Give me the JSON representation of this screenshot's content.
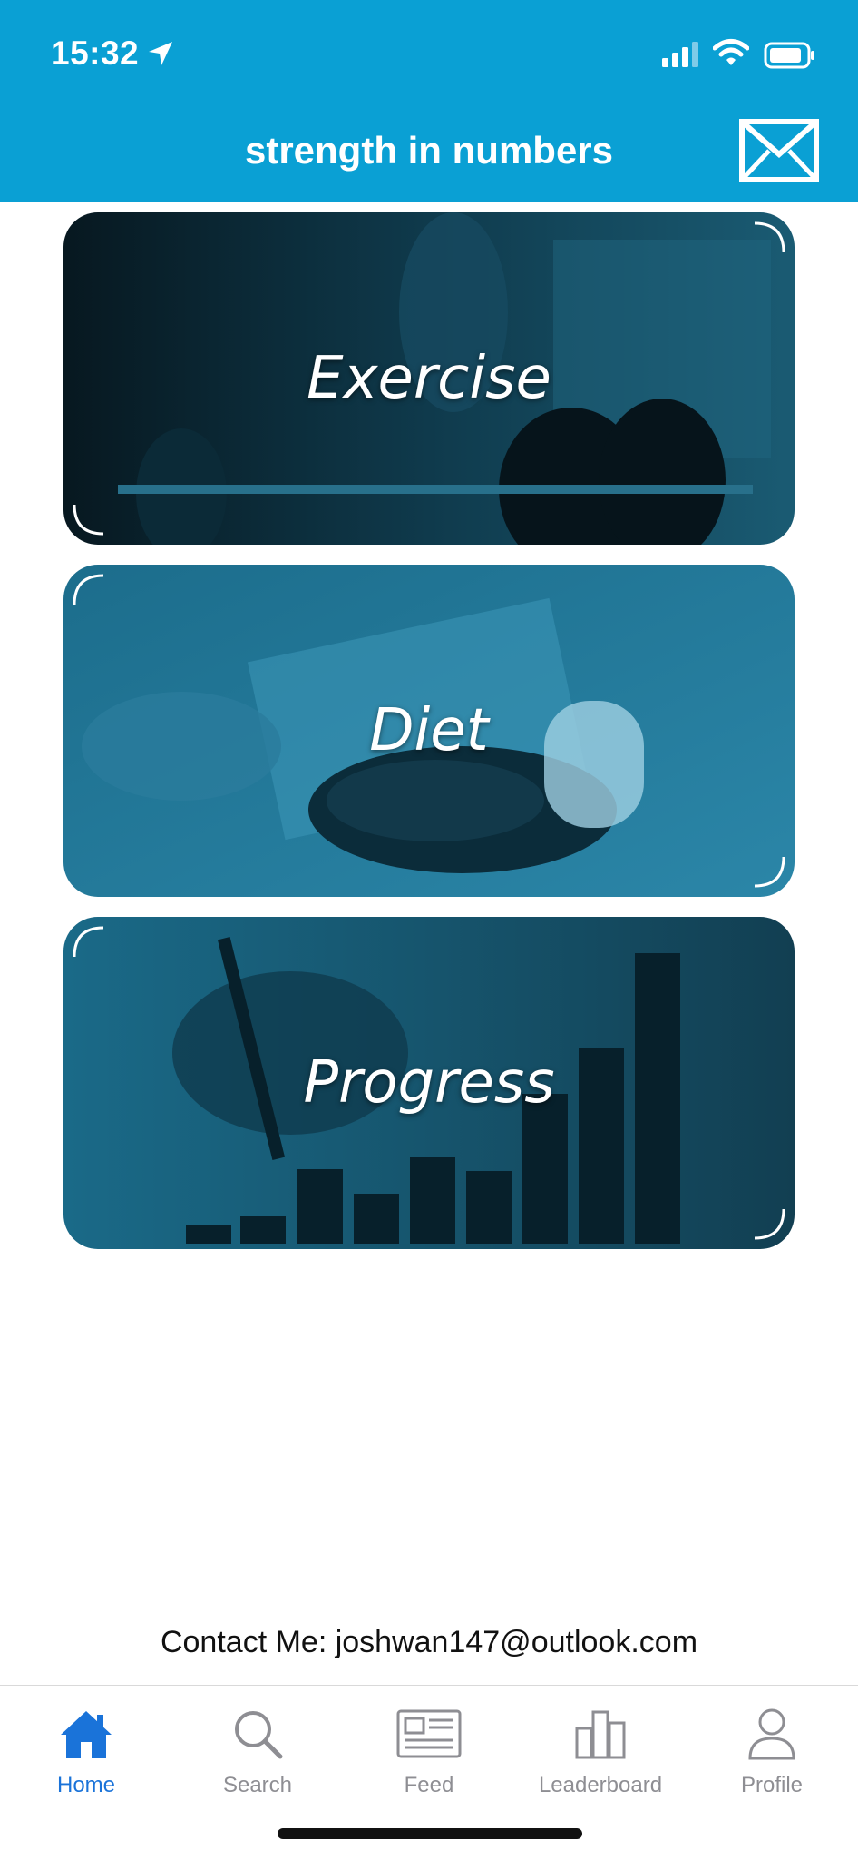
{
  "status": {
    "time": "15:32"
  },
  "header": {
    "title": "strength in numbers"
  },
  "cards": [
    {
      "label": "Exercise"
    },
    {
      "label": "Diet"
    },
    {
      "label": "Progress"
    }
  ],
  "contact": {
    "text": "Contact Me: joshwan147@outlook.com"
  },
  "tabs": [
    {
      "label": "Home",
      "icon": "home-icon"
    },
    {
      "label": "Search",
      "icon": "search-icon"
    },
    {
      "label": "Feed",
      "icon": "newspaper-icon"
    },
    {
      "label": "Leaderboard",
      "icon": "leaderboard-icon"
    },
    {
      "label": "Profile",
      "icon": "person-icon"
    }
  ],
  "colors": {
    "header": "#0aa0d4",
    "tab_active": "#1a73d9",
    "tab_inactive": "#8e8e93",
    "card_tint": "#1b7fa3"
  }
}
